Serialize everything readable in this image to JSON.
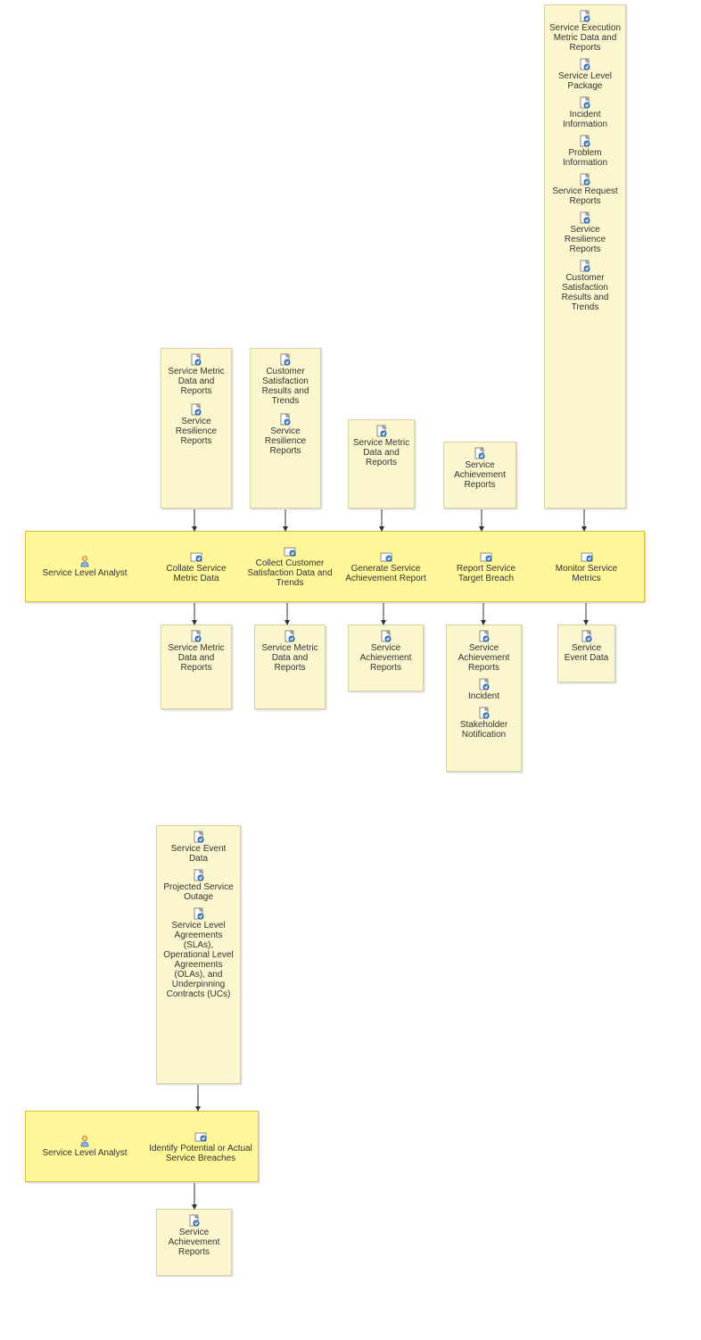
{
  "role": "Service Level Analyst",
  "c1": {
    "in": [
      "Service Metric Data and Reports",
      "Service Resilience Reports"
    ],
    "act": "Collate Service Metric Data",
    "out": [
      "Service Metric Data and Reports"
    ]
  },
  "c2": {
    "in": [
      "Customer Satisfaction Results and Trends",
      "Service Resilience Reports"
    ],
    "act": "Collect Customer Satisfaction Data and Trends",
    "out": [
      "Service Metric Data and Reports"
    ]
  },
  "c3": {
    "in": [
      "Service Metric Data and Reports"
    ],
    "act": "Generate Service Achievement Report",
    "out": [
      "Service Achievement Reports"
    ]
  },
  "c4": {
    "in": [
      "Service Achievement Reports"
    ],
    "act": "Report Service Target Breach",
    "out": [
      "Service Achievement Reports",
      "Incident",
      "Stakeholder Notification"
    ]
  },
  "c5": {
    "in": [
      "Service Execution Metric Data and Reports",
      "Service Level Package",
      "Incident Information",
      "Problem Information",
      "Service Request Reports",
      "Service Resilience Reports",
      "Customer Satisfaction Results and Trends"
    ],
    "act": "Monitor Service Metrics",
    "out": [
      "Service Event Data"
    ]
  },
  "c6": {
    "in": [
      "Service Event Data",
      "Projected Service Outage",
      "Service Level Agreements (SLAs), Operational Level Agreements (OLAs), and Underpinning Contracts (UCs)"
    ],
    "act": "Identify Potential or Actual Service Breaches",
    "out": [
      "Service Achievement Reports"
    ]
  }
}
